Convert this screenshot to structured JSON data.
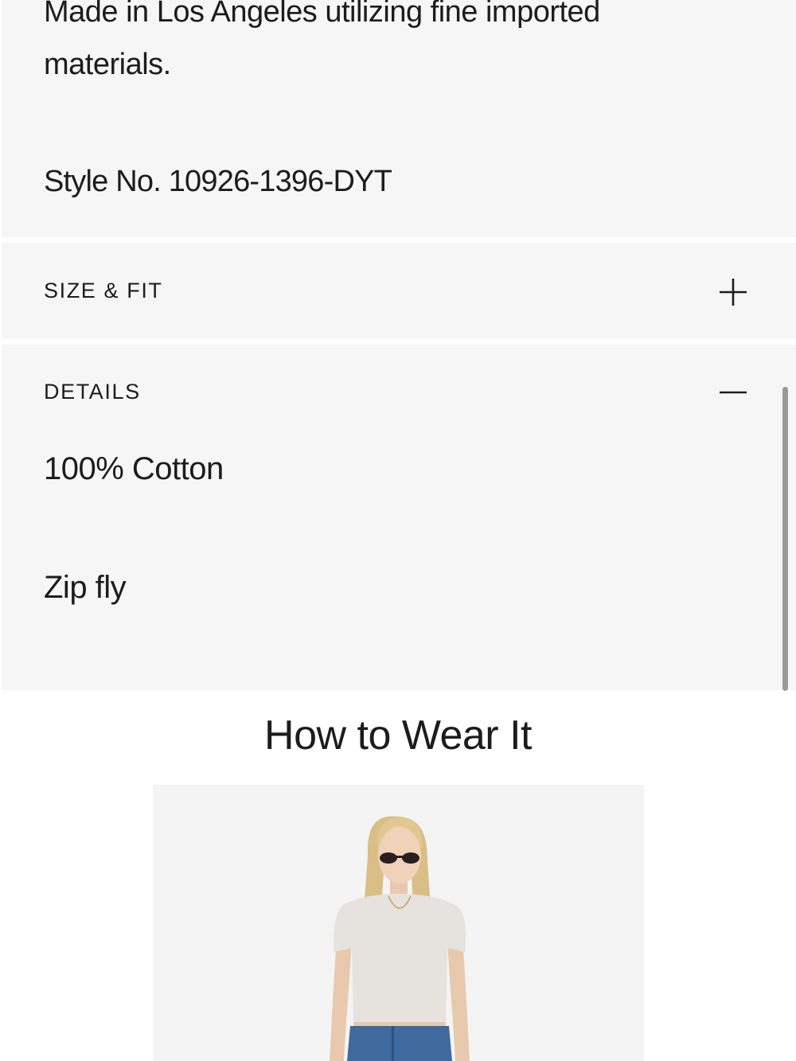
{
  "description": {
    "text": "Made in Los Angeles utilizing fine imported materials.",
    "style_number": "Style No. 10926-1396-DYT"
  },
  "accordions": {
    "size_fit": {
      "title": "SIZE & FIT",
      "icon": "plus-icon",
      "expanded": false
    },
    "details": {
      "title": "DETAILS",
      "icon": "minus-icon",
      "expanded": true,
      "items": [
        "100% Cotton",
        "Zip fly"
      ]
    }
  },
  "how_to_wear": {
    "title": "How to Wear It",
    "image": "model-photo"
  },
  "colors": {
    "panel_bg": "#f6f6f6",
    "text": "#1c1c1c",
    "scrollbar": "#9a9a9a"
  }
}
